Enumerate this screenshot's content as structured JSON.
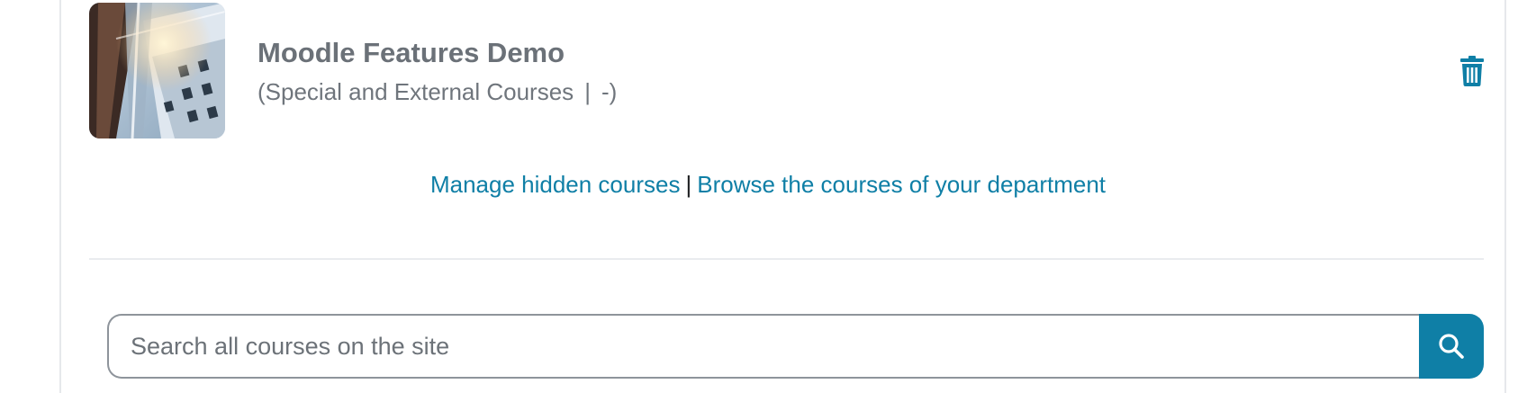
{
  "course": {
    "title": "Moodle Features Demo",
    "category": "(Special and External Courses",
    "separator": "|",
    "tail": "-)",
    "thumbnail_icon": "course-image-building",
    "delete_icon": "trash-icon"
  },
  "links": {
    "manage_hidden": "Manage hidden courses",
    "divider": "|",
    "browse_department": "Browse the courses of your department"
  },
  "search": {
    "placeholder": "Search all courses on the site",
    "value": "",
    "button_icon": "search-icon"
  },
  "colors": {
    "accent": "#0f7fa6",
    "title_text": "#6b7178",
    "muted_text": "#6f757c",
    "divider": "#e9ecef"
  }
}
